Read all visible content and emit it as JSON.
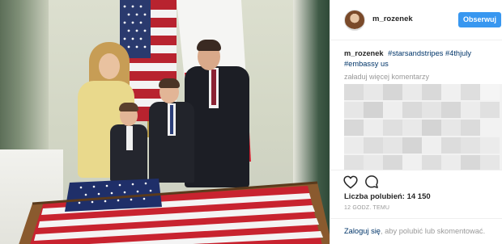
{
  "post": {
    "username": "m_rozenek",
    "follow_label": "Obserwuj",
    "caption": {
      "username": "m_rozenek",
      "tags": [
        "#starsandstripes",
        "#4thjuly",
        "#embassy us"
      ]
    },
    "load_more_label": "załaduj więcej komentarzy",
    "likes_label": "Liczba polubień: 14 150",
    "timestamp": "12 GODZ. TEMU",
    "footer": {
      "login_label": "Zaloguj się",
      "rest_label": ", aby polubić lub skomentować."
    }
  },
  "icons": {
    "like": "heart-icon",
    "comment": "comment-icon",
    "avatar": "avatar"
  },
  "colors": {
    "follow_button": "#3897f0",
    "hashtag": "#003569",
    "muted": "#999999"
  }
}
